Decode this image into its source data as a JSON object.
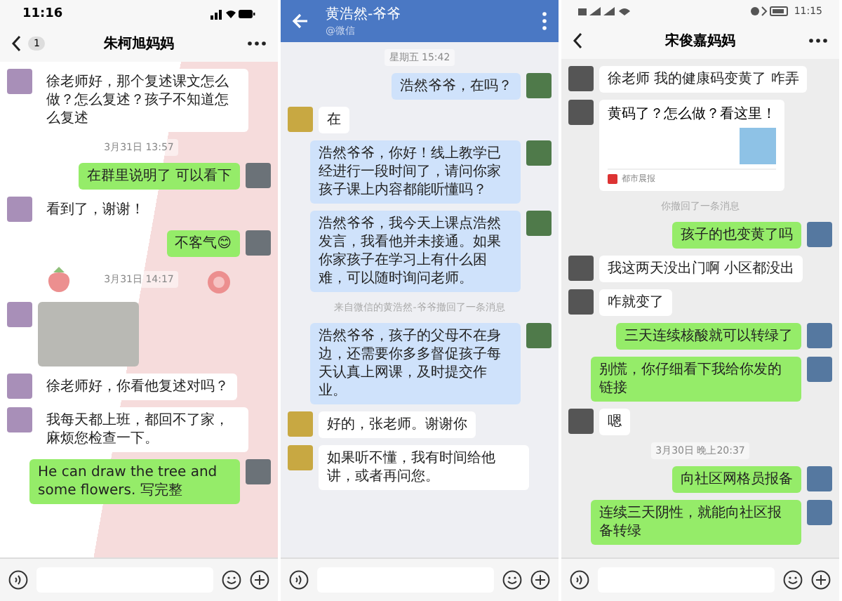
{
  "panels": [
    {
      "kind": "wallpaper",
      "status_bar": {
        "kind": "ios",
        "time": "11:16"
      },
      "header": {
        "kind": "ios",
        "title": "朱柯旭妈妈",
        "badge": "1"
      },
      "messages": [
        {
          "kind": "in",
          "text": "徐老师好，那个复述课文怎么做？怎么复述？孩子不知道怎么复述"
        },
        {
          "kind": "time",
          "text": "3月31日 13:57"
        },
        {
          "kind": "out",
          "text": "在群里说明了 可以看下"
        },
        {
          "kind": "in",
          "text": "看到了，谢谢！"
        },
        {
          "kind": "out",
          "text": "不客气😊"
        },
        {
          "kind": "time",
          "text": "3月31日 14:17"
        },
        {
          "kind": "image"
        },
        {
          "kind": "in",
          "text": "徐老师好，你看他复述对吗？"
        },
        {
          "kind": "in",
          "text": "我每天都上班，都回不了家，麻烦您检查一下。"
        },
        {
          "kind": "out",
          "text": "He can draw the tree and some flowers. 写完整"
        }
      ]
    },
    {
      "kind": "blue",
      "header": {
        "kind": "android",
        "title": "黄浩然-爷爷",
        "subtitle": "@微信"
      },
      "messages": [
        {
          "kind": "time",
          "text": "星期五 15:42"
        },
        {
          "kind": "out",
          "text": "浩然爷爷，在吗？"
        },
        {
          "kind": "in",
          "text": "在"
        },
        {
          "kind": "out",
          "text": "浩然爷爷，你好！线上教学已经进行一段时间了，请问你家孩子课上内容都能听懂吗？"
        },
        {
          "kind": "out",
          "text": "浩然爷爷，我今天上课点浩然发言，我看他并未接通。如果你家孩子在学习上有什么困难，可以随时询问老师。"
        },
        {
          "kind": "system",
          "text": "来自微信的黄浩然-爷爷撤回了一条消息"
        },
        {
          "kind": "out",
          "text": "浩然爷爷，孩子的父母不在身边，还需要你多多督促孩子每天认真上网课，及时提交作业。"
        },
        {
          "kind": "in",
          "text": "好的，张老师。谢谢你"
        },
        {
          "kind": "in",
          "text": "如果听不懂，我有时间给他讲，或者再问您。"
        }
      ]
    },
    {
      "kind": "gray",
      "status_bar": {
        "kind": "android",
        "time": "11:15"
      },
      "header": {
        "kind": "ios",
        "title": "宋俊嘉妈妈"
      },
      "messages": [
        {
          "kind": "in",
          "text": "徐老师 我的健康码变黄了 咋弄"
        },
        {
          "kind": "card",
          "text": "黄码了？怎么做？看这里！",
          "source": "都市晨报"
        },
        {
          "kind": "system",
          "text": "你撤回了一条消息"
        },
        {
          "kind": "out",
          "text": "孩子的也变黄了吗"
        },
        {
          "kind": "in",
          "text": "我这两天没出门啊 小区都没出"
        },
        {
          "kind": "in",
          "text": "咋就变了"
        },
        {
          "kind": "out",
          "text": "三天连续核酸就可以转绿了"
        },
        {
          "kind": "out",
          "text": "别慌，你仔细看下我给你发的链接"
        },
        {
          "kind": "in",
          "text": "嗯"
        },
        {
          "kind": "time",
          "text": "3月30日 晚上20:37"
        },
        {
          "kind": "out",
          "text": "向社区网格员报备"
        },
        {
          "kind": "out",
          "text": "连续三天阴性，就能向社区报备转绿"
        }
      ]
    }
  ]
}
